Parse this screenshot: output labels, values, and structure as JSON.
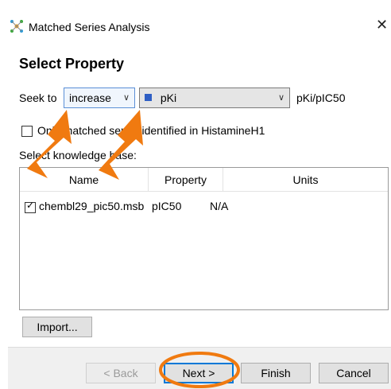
{
  "window": {
    "title": "Matched Series Analysis",
    "close_glyph": "✕"
  },
  "page": {
    "heading": "Select Property"
  },
  "seek": {
    "label": "Seek to",
    "direction_value": "increase",
    "property_value": "pKi",
    "property_swatch_color": "#2f5fc4",
    "units_label": "pKi/pIC50"
  },
  "options": {
    "only_identified_label": "Only matched series identified in HistamineH1",
    "only_identified_checked": false,
    "knowledge_base_label": "Select knowledge base:"
  },
  "table": {
    "columns": [
      "Name",
      "Property",
      "Units"
    ],
    "rows": [
      {
        "checked": true,
        "name": "chembl29_pic50.msb",
        "property": "pIC50",
        "units": "N/A"
      }
    ]
  },
  "buttons": {
    "import": "Import...",
    "back": "< Back",
    "next": "Next >",
    "finish": "Finish",
    "cancel": "Cancel"
  },
  "annotations": {
    "arrow_color": "#f07a10",
    "highlight_color": "#f07a10"
  },
  "icons": {
    "app": "matched-series-app-icon",
    "close": "close-icon",
    "chevron": "chevron-down-icon"
  }
}
